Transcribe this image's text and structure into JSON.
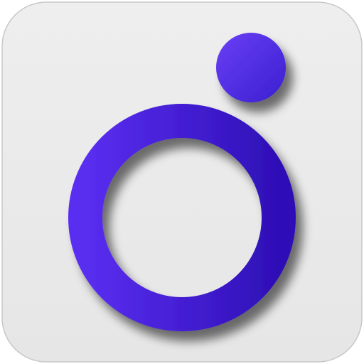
{
  "icon": {
    "name": "circle-and-dot-app-icon",
    "tile_color": "#ebebeb",
    "border_color": "#c8c8c8",
    "ring_color_light": "#5a2ef0",
    "ring_color_dark": "#2e0fb6",
    "dot_color_light": "#6a3ff5",
    "dot_color_dark": "#3a1fd0"
  }
}
